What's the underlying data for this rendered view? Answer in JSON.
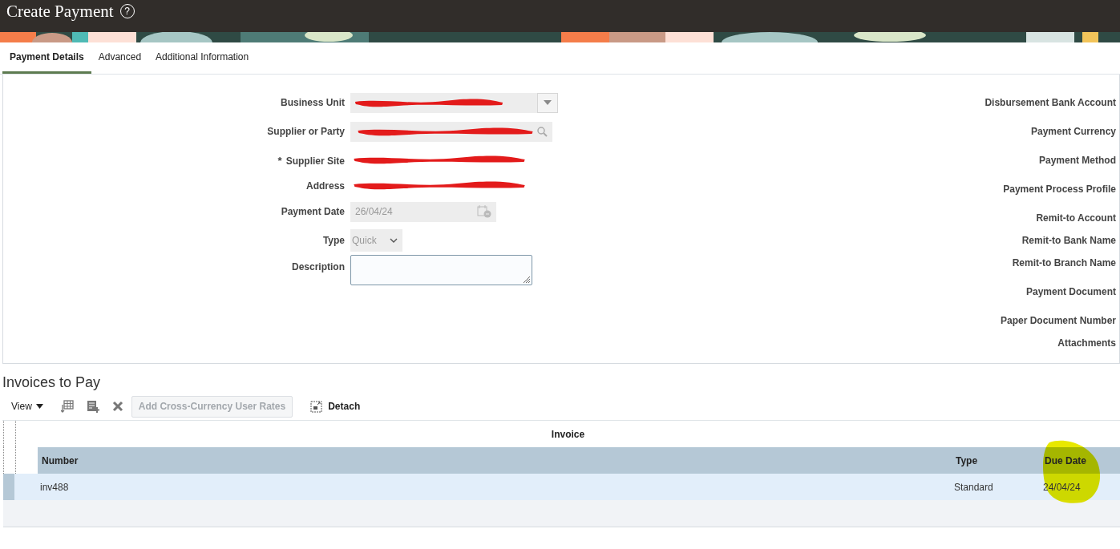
{
  "header": {
    "title": "Create Payment",
    "help": "?"
  },
  "tabs": [
    {
      "label": "Payment Details",
      "selected": true
    },
    {
      "label": "Advanced",
      "selected": false
    },
    {
      "label": "Additional Information",
      "selected": false
    }
  ],
  "form": {
    "required_symbol": "*",
    "left": [
      {
        "label": "Business Unit",
        "kind": "select",
        "required": false,
        "redacted": true
      },
      {
        "label": "Supplier or Party",
        "kind": "search",
        "required": false,
        "redacted": true
      },
      {
        "label": "Supplier Site",
        "kind": "text",
        "required": true,
        "redacted": true
      },
      {
        "label": "Address",
        "kind": "text",
        "required": false,
        "redacted": true
      },
      {
        "label": "Payment Date",
        "kind": "date",
        "required": false,
        "redacted": false,
        "value": "26/04/24"
      },
      {
        "label": "Type",
        "kind": "choice",
        "required": false,
        "redacted": false,
        "value": "Quick"
      },
      {
        "label": "Description",
        "kind": "textarea",
        "required": false,
        "redacted": false
      }
    ],
    "right": [
      "Disbursement Bank Account",
      "Payment Currency",
      "Payment Method",
      "Payment Process Profile",
      "Remit-to Account",
      "Remit-to Bank Name",
      "Remit-to Branch Name",
      "Payment Document",
      "Paper Document Number",
      "Attachments"
    ]
  },
  "invoices": {
    "title": "Invoices to Pay",
    "toolbar": {
      "view": "View",
      "rates_button": {
        "label": "Add Cross-Currency User Rates",
        "disabled": true
      },
      "detach": "Detach"
    },
    "group_header": "Invoice",
    "columns": [
      {
        "label": "Number",
        "highlighted": false
      },
      {
        "label": "Type",
        "highlighted": false
      },
      {
        "label": "Due Date",
        "highlighted": true
      }
    ],
    "rows": [
      {
        "cells": [
          "inv488",
          "Standard",
          "24/04/24"
        ],
        "selected": true
      }
    ]
  }
}
